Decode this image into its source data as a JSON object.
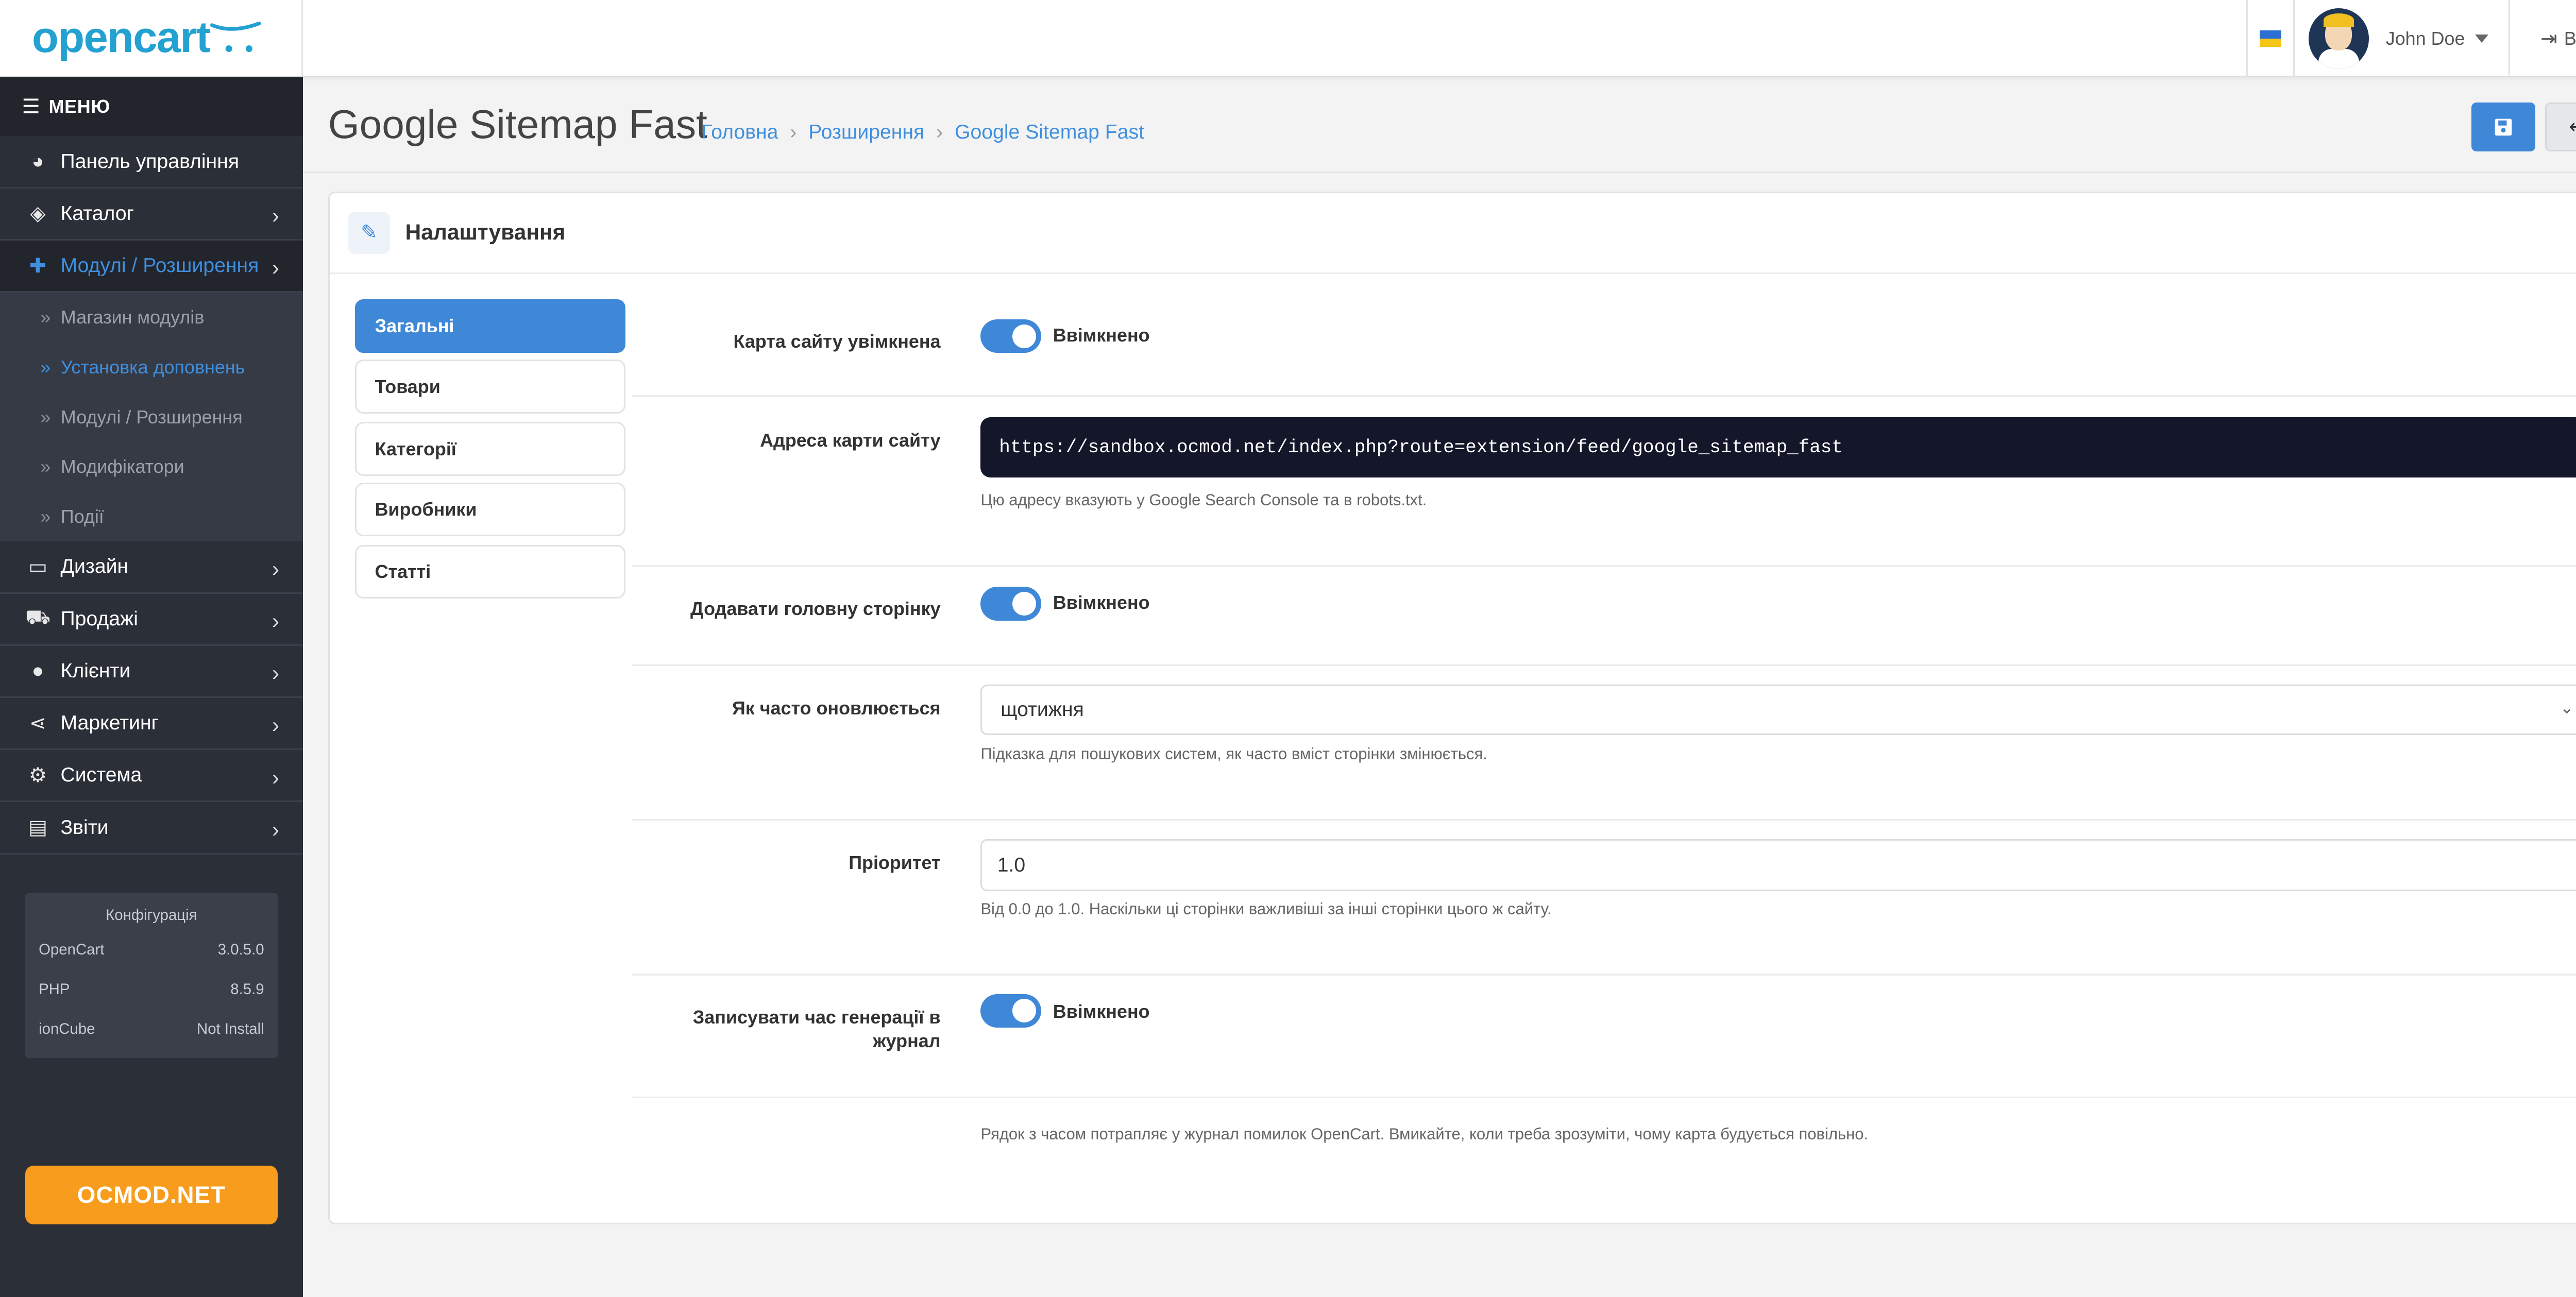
{
  "header": {
    "logo": "opencart",
    "user_name": "John Doe",
    "logout_label": "Вихід",
    "flag": "ukraine-flag"
  },
  "sidebar": {
    "menu_label": "МЕНЮ",
    "items": [
      {
        "label": "Панель управління",
        "icon": "dashboard-icon"
      },
      {
        "label": "Каталог",
        "icon": "tags-icon"
      },
      {
        "label": "Модулі / Розширення",
        "icon": "puzzle-icon",
        "active": true
      },
      {
        "label": "Дизайн",
        "icon": "desktop-icon"
      },
      {
        "label": "Продажі",
        "icon": "cart-icon"
      },
      {
        "label": "Клієнти",
        "icon": "user-icon"
      },
      {
        "label": "Маркетинг",
        "icon": "share-icon"
      },
      {
        "label": "Система",
        "icon": "gear-icon"
      },
      {
        "label": "Звіти",
        "icon": "chart-icon"
      }
    ],
    "sub_items": [
      {
        "label": "Магазин модулів"
      },
      {
        "label": "Установка доповнень",
        "current": true
      },
      {
        "label": "Модулі / Розширення"
      },
      {
        "label": "Модифікатори"
      },
      {
        "label": "Події"
      }
    ],
    "config": {
      "title": "Конфігурація",
      "rows": [
        {
          "name": "OpenCart",
          "value": "3.0.5.0"
        },
        {
          "name": "PHP",
          "value": "8.5.9"
        },
        {
          "name": "ionCube",
          "value": "Not Install"
        }
      ]
    },
    "promo": "OCMOD.NET"
  },
  "page": {
    "title": "Google Sitemap Fast",
    "breadcrumb": [
      "Головна",
      "Розширення",
      "Google Sitemap Fast"
    ]
  },
  "card": {
    "title": "Налаштування",
    "tabs": [
      "Загальні",
      "Товари",
      "Категорії",
      "Виробники",
      "Статті"
    ],
    "active_tab": "Загальні",
    "fields": {
      "sitemap_enabled": {
        "label": "Карта сайту увімкнена",
        "state": "Ввімкнено"
      },
      "sitemap_url": {
        "label": "Адреса карти сайту",
        "value": "https://sandbox.ocmod.net/index.php?route=extension/feed/google_sitemap_fast",
        "help": "Цю адресу вказують у Google Search Console та в robots.txt."
      },
      "add_home": {
        "label": "Додавати головну сторінку",
        "state": "Ввімкнено"
      },
      "changefreq": {
        "label": "Як часто оновлюється",
        "value": "щотижня",
        "help": "Підказка для пошукових систем, як часто вміст сторінки змінюється."
      },
      "priority": {
        "label": "Пріоритет",
        "value": "1.0",
        "help": "Від 0.0 до 1.0. Наскільки ці сторінки важливіші за інші сторінки цього ж сайту."
      },
      "log_time": {
        "label_line1": "Записувати час генерації в",
        "label_line2": "журнал",
        "state": "Ввімкнено",
        "help": "Рядок з часом потрапляє у журнал помилок OpenCart. Вмикайте, коли треба зрозуміти, чому карта будується повільно."
      }
    }
  },
  "colors": {
    "accent": "#3f88d8",
    "sidebar_bg": "#2b2f38",
    "promo": "#f79c1d",
    "logo": "#23a1d1"
  }
}
